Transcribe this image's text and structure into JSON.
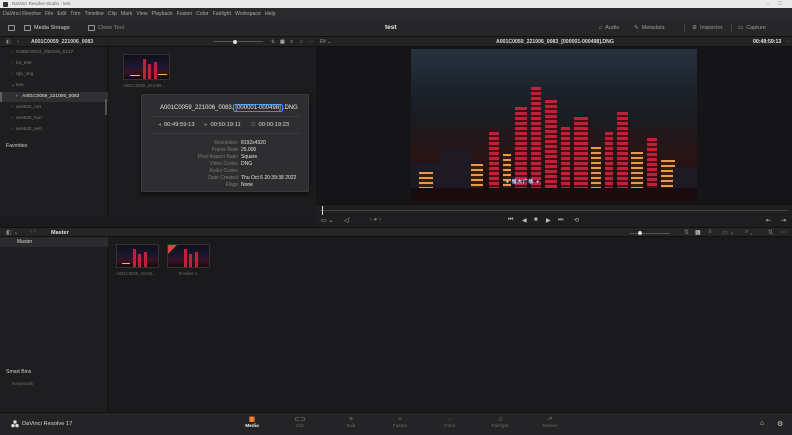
{
  "window": {
    "title": "DaVinci Resolve Studio - test"
  },
  "menu": [
    "DaVinci Resolve",
    "File",
    "Edit",
    "Trim",
    "Timeline",
    "Clip",
    "Mark",
    "View",
    "Playback",
    "Fusion",
    "Color",
    "Fairlight",
    "Workspace",
    "Help"
  ],
  "toolbar": {
    "media_storage": "Media Storage",
    "clone_tool": "Clone Tool",
    "project_title": "test",
    "audio": "Audio",
    "metadata": "Metadata",
    "inspector": "Inspector",
    "capture": "Capture"
  },
  "media_storage": {
    "path": "A001C0059_221006_0083",
    "items": [
      {
        "label": "K065C0023_230315_0137",
        "expanded": false
      },
      {
        "label": "lut_test",
        "expanded": false
      },
      {
        "label": "rgb_img",
        "expanded": false
      },
      {
        "label": "test",
        "expanded": true
      },
      {
        "label": "A001C0059_221006_0083",
        "expanded": false,
        "selected": true
      },
      {
        "label": "wm630_run",
        "expanded": false
      },
      {
        "label": "wm630_sun",
        "expanded": false
      },
      {
        "label": "wm630_test",
        "expanded": false
      }
    ],
    "favorites": "Favorites"
  },
  "browser": {
    "thumb_caption": "A001C0059_221006..."
  },
  "tooltip": {
    "name_prefix": "A001C0059_221006_0083.",
    "name_highlight": "[000001-000498]",
    "name_suffix": ".DNG",
    "tc_start": "00:49:59:13",
    "tc_end": "00:50:19:11",
    "tc_duration": "00:00:19:23",
    "meta": [
      {
        "k": "Resolution",
        "v": "8192x4320"
      },
      {
        "k": "Frame Rate",
        "v": "25.000"
      },
      {
        "k": "Pixel Aspect Ratio",
        "v": "Square"
      },
      {
        "k": "Video Codec",
        "v": "DNG"
      },
      {
        "k": "Audio Codec",
        "v": ""
      },
      {
        "k": "Date Created",
        "v": "Thu Oct  6 20:39:38 2022"
      },
      {
        "k": "Flags",
        "v": "None"
      }
    ]
  },
  "viewer": {
    "fit": "Fit",
    "clip_name": "A001C0059_221006_0083_[000001-000498].DNG",
    "timecode": "00:49:59:13",
    "sign_text": "● 恒大广场 ●"
  },
  "lower": {
    "bin_title": "Master"
  },
  "bins": {
    "master": "Master",
    "smart_bins": "Smart Bins",
    "keywords": "Keywords"
  },
  "pool": [
    {
      "caption": "A001C0059_22106..."
    },
    {
      "caption": "Timeline 1"
    }
  ],
  "pagebar": {
    "brand": "DaVinci Resolve 17",
    "pages": [
      {
        "label": "Media",
        "icon": "▣",
        "active": true
      },
      {
        "label": "Cut",
        "icon": "⊏⊐",
        "active": false
      },
      {
        "label": "Edit",
        "icon": "≡",
        "active": false
      },
      {
        "label": "Fusion",
        "icon": "✧",
        "active": false
      },
      {
        "label": "Color",
        "icon": "◌",
        "active": false
      },
      {
        "label": "Fairlight",
        "icon": "♫",
        "active": false
      },
      {
        "label": "Deliver",
        "icon": "⬏",
        "active": false
      }
    ]
  },
  "colors": {
    "accent": "#ff8a2b",
    "highlight": "#3b8bff"
  }
}
